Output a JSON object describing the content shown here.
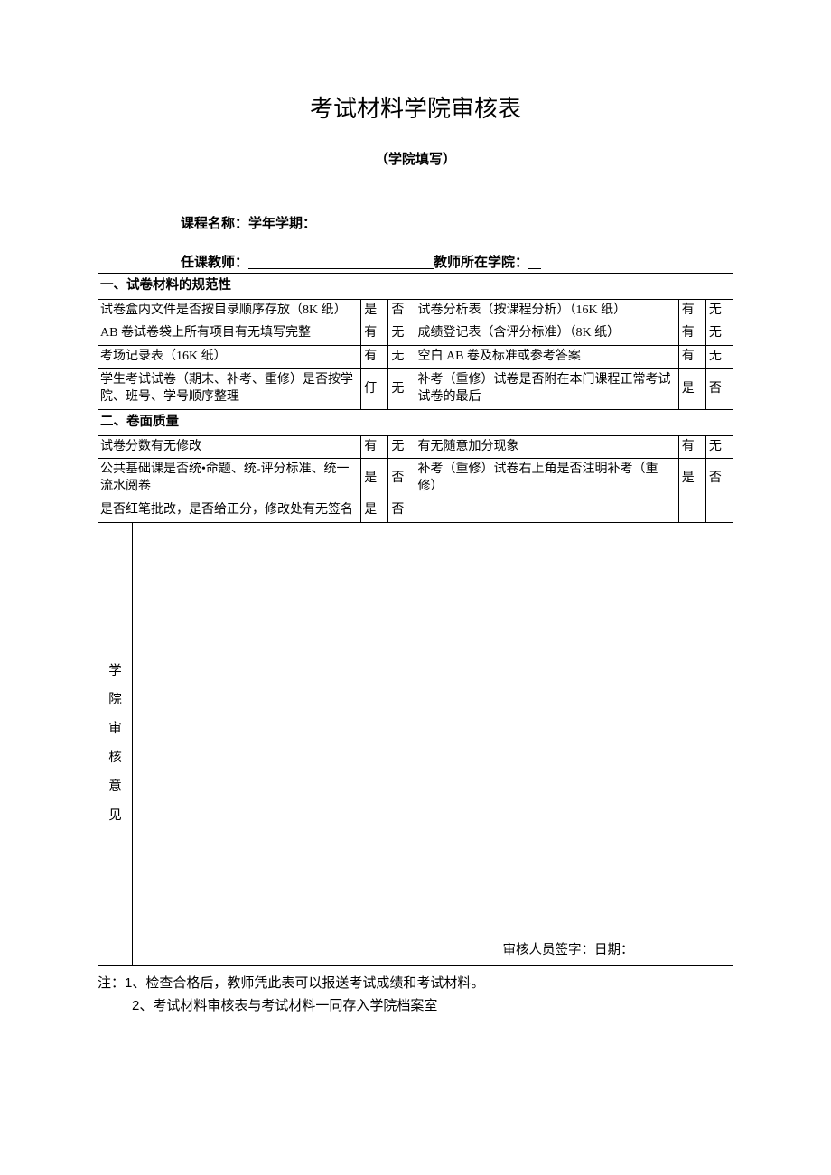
{
  "title": "考试材料学院审核表",
  "subtitle": "（学院填写）",
  "info": {
    "course_label": "课程名称：学年学期：",
    "teacher_label": "任课教师：",
    "college_label": "教师所在学院："
  },
  "section1": {
    "header": "一、试卷材料的规范性",
    "rows": [
      {
        "left_label": "试卷盒内文件是否按目录顺序存放（8K 纸）",
        "left_opt1": "是",
        "left_opt2": "否",
        "right_label": "试卷分析表（按课程分析）（16K 纸）",
        "right_opt1": "有",
        "right_opt2": "无"
      },
      {
        "left_label": "AB 卷试卷袋上所有项目有无填写完整",
        "left_opt1": "有",
        "left_opt2": "无",
        "right_label": "成绩登记表（含评分标准）（8K 纸）",
        "right_opt1": "有",
        "right_opt2": "无"
      },
      {
        "left_label": "考场记录表（16K 纸）",
        "left_opt1": "有",
        "left_opt2": "无",
        "right_label": "空白 AB 卷及标准或参考答案",
        "right_opt1": "有",
        "right_opt2": "无"
      },
      {
        "left_label": "学生考试试卷（期末、补考、重修）是否按学院、班号、学号顺序整理",
        "left_opt1": "仃",
        "left_opt2": "无",
        "right_label": "补考（重修）试卷是否附在本门课程正常考试试卷的最后",
        "right_opt1": "是",
        "right_opt2": "否"
      }
    ]
  },
  "section2": {
    "header": "二、卷面质量",
    "rows": [
      {
        "left_label": "试卷分数有无修改",
        "left_opt1": "有",
        "left_opt2": "无",
        "right_label": "有无随意加分现象",
        "right_opt1": "有",
        "right_opt2": "无"
      },
      {
        "left_label": "公共基础课是否统•命题、统-评分标准、统一流水阅卷",
        "left_opt1": "是",
        "left_opt2": "否",
        "right_label": "补考（重修）试卷右上角是否注明补考（重修）",
        "right_opt1": "是",
        "right_opt2": "否"
      },
      {
        "left_label": "是否红笔批改，是否给正分，修改处有无签名",
        "left_opt1": "是",
        "left_opt2": "否",
        "right_label": "",
        "right_opt1": "",
        "right_opt2": ""
      }
    ]
  },
  "opinion": {
    "label": "学\n院\n审\n核\n意\n见",
    "signature_line": "审核人员签字：日期："
  },
  "notes": {
    "line1": "注：1、检查合格后，教师凭此表可以报送考试成绩和考试材料。",
    "line2": "2、考试材料审核表与考试材料一同存入学院档案室"
  }
}
